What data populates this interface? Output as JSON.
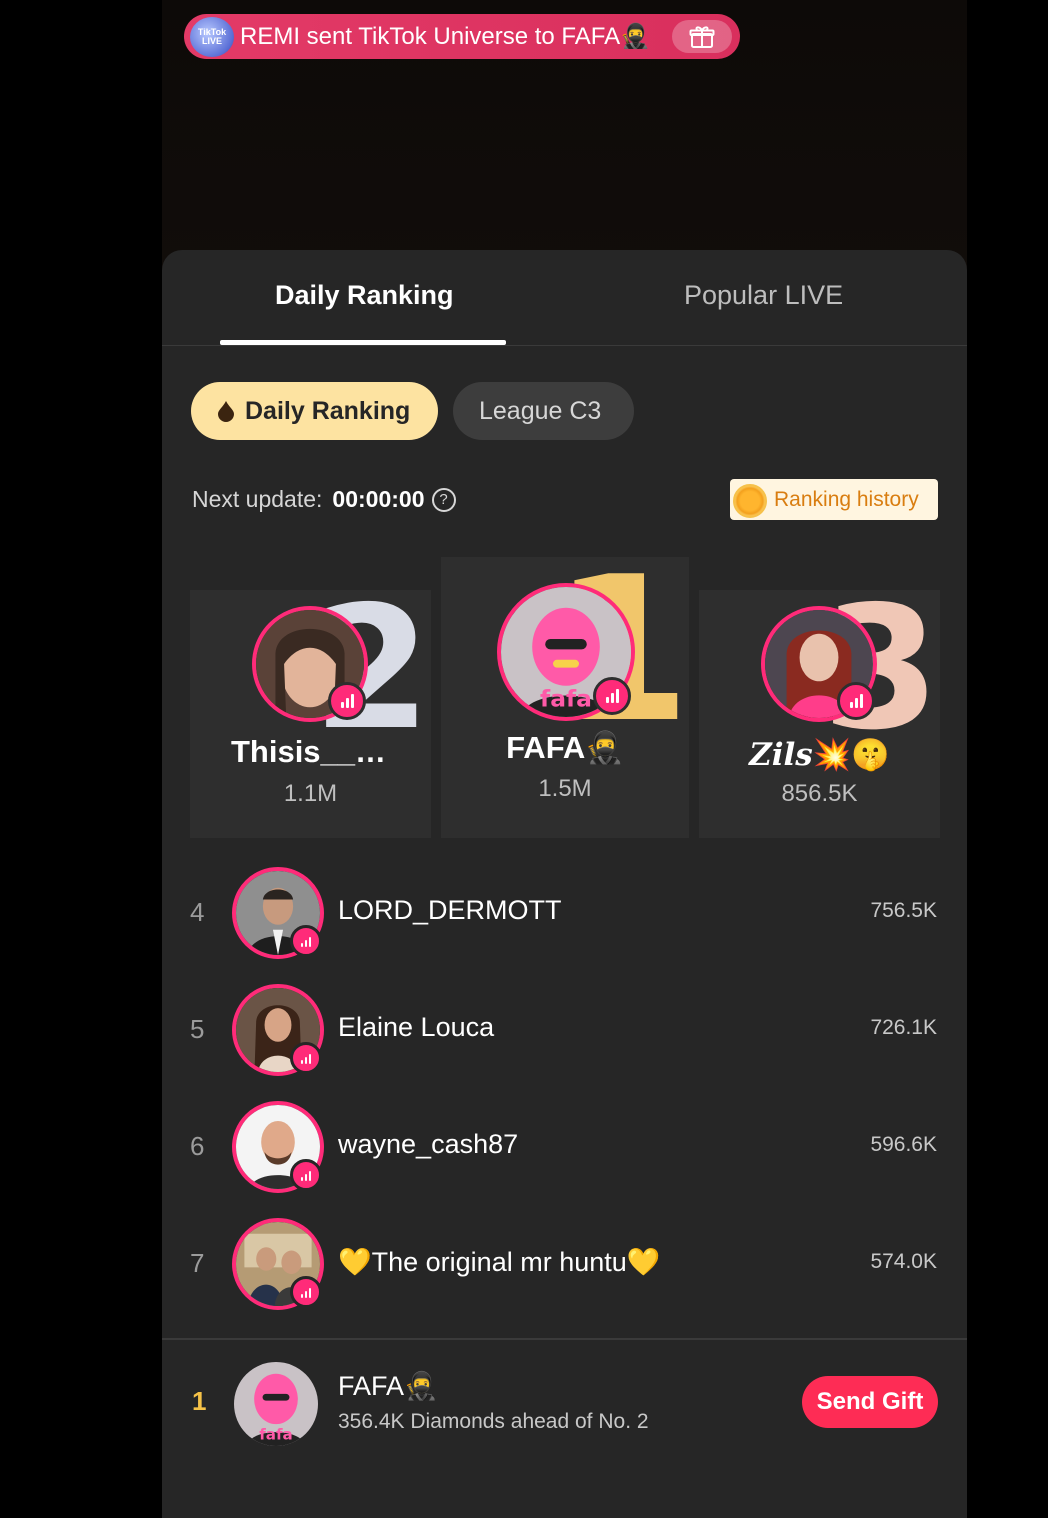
{
  "banner": {
    "badge_text": "TikTok LIVE",
    "text": "REMI sent TikTok Universe to FAFA",
    "gift_icon": "gift-icon"
  },
  "tabs": [
    {
      "label": "Daily Ranking",
      "active": true
    },
    {
      "label": "Popular LIVE",
      "active": false
    }
  ],
  "filters": {
    "daily": "Daily Ranking",
    "league": "League C3"
  },
  "next_update": {
    "label": "Next update:",
    "time": "00:00:00"
  },
  "ranking_history": "Ranking history",
  "podium": {
    "first": {
      "rank": "1",
      "name": "FAFA",
      "score": "1.5M"
    },
    "second": {
      "rank": "2",
      "name": "Thisis__…",
      "score": "1.1M"
    },
    "third": {
      "rank": "3",
      "name": "Zils",
      "score": "856.5K"
    }
  },
  "list": [
    {
      "rank": "4",
      "name": "LORD_DERMOTT",
      "score": "756.5K"
    },
    {
      "rank": "5",
      "name": "Elaine Louca",
      "score": "726.1K"
    },
    {
      "rank": "6",
      "name": "wayne_cash87",
      "score": "596.6K"
    },
    {
      "rank": "7",
      "name": "The original mr huntu",
      "score": "574.0K"
    }
  ],
  "self": {
    "rank": "1",
    "name": "FAFA",
    "subtitle": "356.4K Diamonds ahead of No. 2",
    "button": "Send Gift"
  },
  "colors": {
    "accent_pink": "#ff2b79",
    "send_gift": "#fe2c55",
    "pill_active": "#fde3a1",
    "gold": "#f1c66b"
  }
}
